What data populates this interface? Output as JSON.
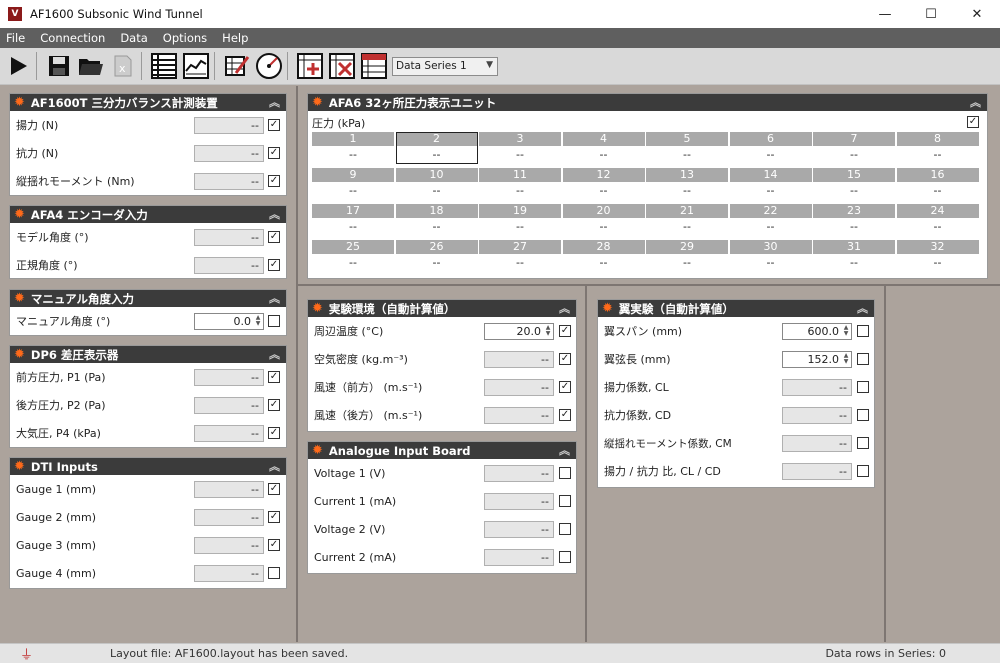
{
  "window": {
    "title": "AF1600 Subsonic Wind Tunnel",
    "icon_text": "V",
    "buttons": {
      "minimize": "—",
      "maximize": "☐",
      "close": "✕"
    }
  },
  "menu": {
    "file": "File",
    "connection": "Connection",
    "data": "Data",
    "options": "Options",
    "help": "Help"
  },
  "toolbar": {
    "series_selected": "Data Series 1",
    "icons": [
      "play-icon",
      "save-icon",
      "open-folder-icon",
      "excel-export-icon",
      "table-view-icon",
      "chart-view-icon",
      "edit-table-icon",
      "gauge-icon",
      "add-row-icon",
      "delete-row-icon",
      "clear-table-icon"
    ]
  },
  "panels": {
    "balance": {
      "title": "AF1600T 三分力バランス計測装置",
      "rows": [
        {
          "label": "揚力 (N)",
          "value": "--",
          "checked": true
        },
        {
          "label": "抗力 (N)",
          "value": "--",
          "checked": true
        },
        {
          "label": "縦揺れモーメント (Nm)",
          "value": "--",
          "checked": true
        }
      ]
    },
    "encoder": {
      "title": "AFA4 エンコーダ入力",
      "rows": [
        {
          "label": "モデル角度 (°)",
          "value": "--",
          "checked": true
        },
        {
          "label": "正規角度 (°)",
          "value": "--",
          "checked": true
        }
      ]
    },
    "manual_angle": {
      "title": "マニュアル角度入力",
      "rows": [
        {
          "label": "マニュアル角度 (°)",
          "value": "0.0",
          "checked": false
        }
      ]
    },
    "dp6": {
      "title": "DP6 差圧表示器",
      "rows": [
        {
          "label": "前方圧力, P1 (Pa)",
          "value": "--",
          "checked": true
        },
        {
          "label": "後方圧力, P2 (Pa)",
          "value": "--",
          "checked": true
        },
        {
          "label": "大気圧, P4 (kPa)",
          "value": "--",
          "checked": true
        }
      ]
    },
    "dti": {
      "title": "DTI Inputs",
      "rows": [
        {
          "label": "Gauge 1 (mm)",
          "value": "--",
          "checked": true
        },
        {
          "label": "Gauge 2 (mm)",
          "value": "--",
          "checked": true
        },
        {
          "label": "Gauge 3 (mm)",
          "value": "--",
          "checked": true
        },
        {
          "label": "Gauge 4 (mm)",
          "value": "--",
          "checked": false
        }
      ]
    },
    "afa6": {
      "title": "AFA6 32ヶ所圧力表示ユニット",
      "subtitle": "圧力 (kPa)",
      "checked": true,
      "channels": [
        "1",
        "2",
        "3",
        "4",
        "5",
        "6",
        "7",
        "8",
        "9",
        "10",
        "11",
        "12",
        "13",
        "14",
        "15",
        "16",
        "17",
        "18",
        "19",
        "20",
        "21",
        "22",
        "23",
        "24",
        "25",
        "26",
        "27",
        "28",
        "29",
        "30",
        "31",
        "32"
      ],
      "values": [
        "--",
        "--",
        "--",
        "--",
        "--",
        "--",
        "--",
        "--",
        "--",
        "--",
        "--",
        "--",
        "--",
        "--",
        "--",
        "--",
        "--",
        "--",
        "--",
        "--",
        "--",
        "--",
        "--",
        "--",
        "--",
        "--",
        "--",
        "--",
        "--",
        "--",
        "--",
        "--"
      ]
    },
    "env": {
      "title": "実験環境（自動計算値）",
      "rows": [
        {
          "label": "周辺温度 (°C)",
          "value": "20.0",
          "checked": true
        },
        {
          "label": "空気密度 (kg.m⁻³)",
          "value": "--",
          "checked": true
        },
        {
          "label": "風速（前方） (m.s⁻¹)",
          "value": "--",
          "checked": true
        },
        {
          "label": "風速（後方） (m.s⁻¹)",
          "value": "--",
          "checked": true
        }
      ]
    },
    "analogue": {
      "title": "Analogue Input Board",
      "rows": [
        {
          "label": "Voltage 1 (V)",
          "value": "--",
          "checked": false
        },
        {
          "label": "Current 1 (mA)",
          "value": "--",
          "checked": false
        },
        {
          "label": "Voltage 2 (V)",
          "value": "--",
          "checked": false
        },
        {
          "label": "Current 2 (mA)",
          "value": "--",
          "checked": false
        }
      ]
    },
    "wing": {
      "title": "翼実験（自動計算値）",
      "rows": [
        {
          "label": "翼スパン (mm)",
          "value": "600.0",
          "checked": false
        },
        {
          "label": "翼弦長 (mm)",
          "value": "152.0",
          "checked": false
        },
        {
          "label": "揚力係数, CL",
          "value": "--",
          "checked": false
        },
        {
          "label": "抗力係数, CD",
          "value": "--",
          "checked": false
        },
        {
          "label": "縦揺れモーメント係数, CM",
          "value": "--",
          "checked": false
        },
        {
          "label": "揚力 / 抗力 比, CL / CD",
          "value": "--",
          "checked": false
        }
      ]
    }
  },
  "status": {
    "message": "Layout file: AF1600.layout has been saved.",
    "rows_label": "Data rows in Series: 0"
  },
  "colors": {
    "panel_header": "#3b3b3b",
    "gear": "#ff6a1a",
    "workspace": "#aca39c",
    "menubar": "#5f5f5f"
  }
}
